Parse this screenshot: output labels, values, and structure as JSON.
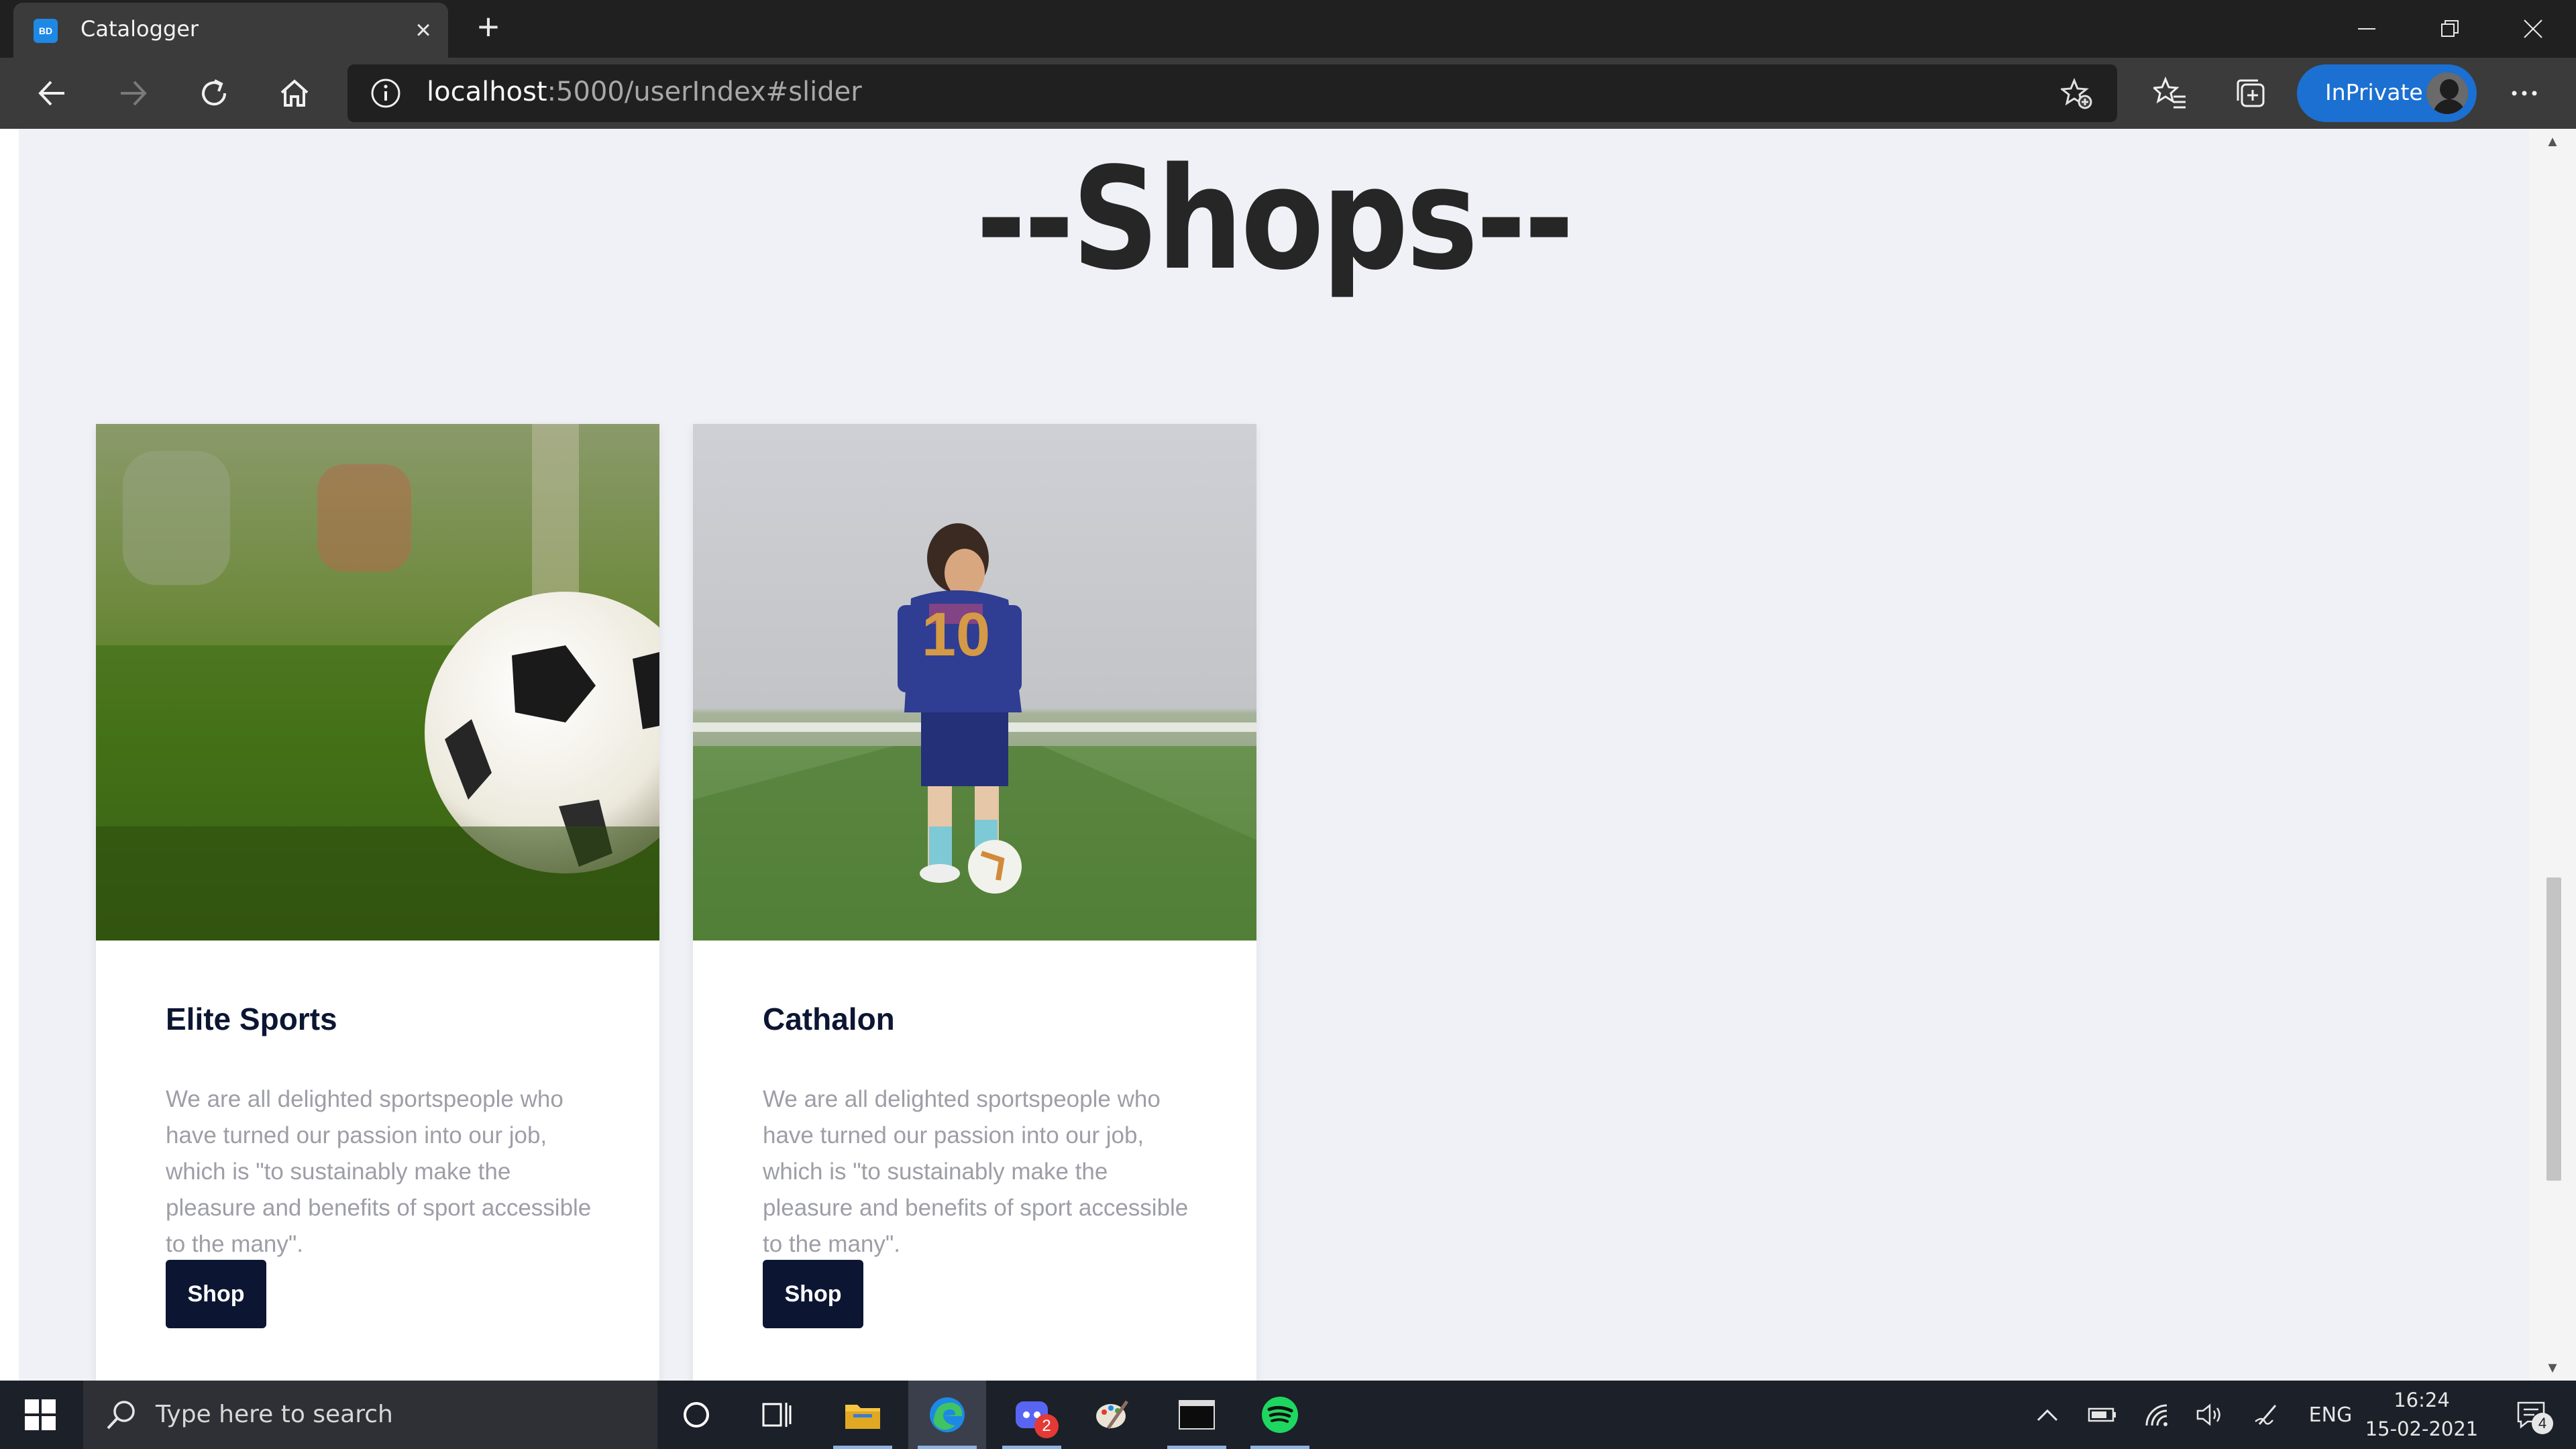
{
  "browser": {
    "tab": {
      "title": "Catalogger",
      "favicon_text": "BD"
    },
    "url_host": "localhost",
    "url_rest": ":5000/userIndex#slider",
    "inprivate_label": "InPrivate",
    "icons": [
      "back-icon",
      "forward-icon",
      "refresh-icon",
      "home-icon",
      "info-icon",
      "add-favorite-icon",
      "favorites-icon",
      "collections-icon",
      "more-icon"
    ]
  },
  "page": {
    "heading": "--Shops--",
    "cards": [
      {
        "title": "Elite Sports",
        "description": "We are all delighted sportspeople who have turned our passion into our job, which is \"to sustainably make the pleasure and benefits of sport accessible to the many\".",
        "button": "Shop",
        "image": "soccer ball on grass"
      },
      {
        "title": "Cathalon",
        "description": "We are all delighted sportspeople who have turned our passion into our job, which is \"to sustainably make the pleasure and benefits of sport accessible to the many\".",
        "button": "Shop",
        "image": "child in number 10 jersey with football"
      }
    ]
  },
  "taskbar": {
    "search_placeholder": "Type here to search",
    "discord_badge": "2",
    "language": "ENG",
    "time": "16:24",
    "date": "15-02-2021",
    "notification_count": "4"
  },
  "colors": {
    "accent_navy": "#0c1633",
    "page_bg": "#f0f1f6",
    "inprivate_blue": "#1b70d1"
  }
}
